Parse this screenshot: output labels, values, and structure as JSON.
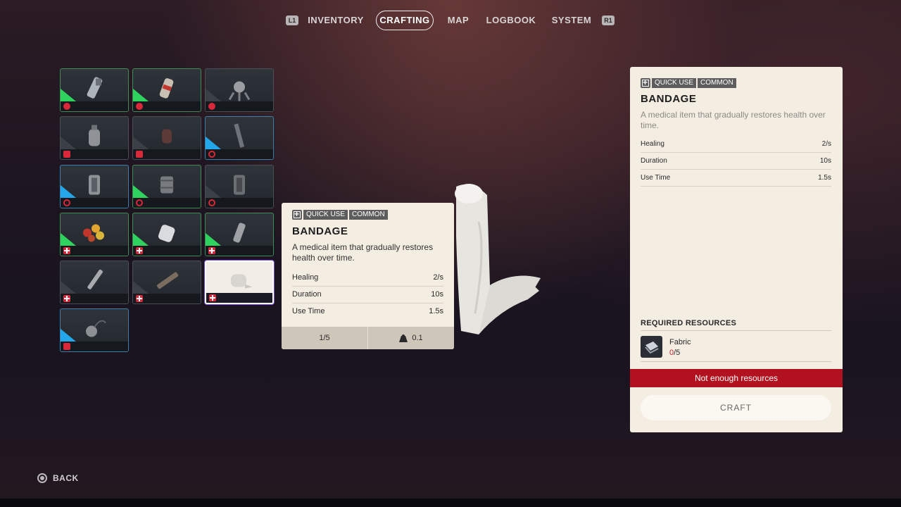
{
  "nav": {
    "left_key": "L1",
    "right_key": "R1",
    "tabs": [
      "INVENTORY",
      "CRAFTING",
      "MAP",
      "LOGBOOK",
      "SYSTEM"
    ],
    "active": "CRAFTING"
  },
  "grid": {
    "items": [
      {
        "name": "stun-gun-icon",
        "rarity": "uncommon",
        "badge": "round"
      },
      {
        "name": "canister-icon",
        "rarity": "uncommon",
        "badge": "round"
      },
      {
        "name": "turret-icon",
        "rarity": "common",
        "badge": "round"
      },
      {
        "name": "bottle-icon",
        "rarity": "common",
        "badge": "dot"
      },
      {
        "name": "grenade-icon",
        "rarity": "common",
        "badge": "dot"
      },
      {
        "name": "flare-icon",
        "rarity": "rare",
        "badge": "target"
      },
      {
        "name": "lantern-icon",
        "rarity": "rare",
        "badge": "target"
      },
      {
        "name": "trap-icon",
        "rarity": "uncommon",
        "badge": "target"
      },
      {
        "name": "lantern-icon-2",
        "rarity": "common",
        "badge": "target"
      },
      {
        "name": "fruit-icon",
        "rarity": "uncommon",
        "badge": "plus"
      },
      {
        "name": "roll-icon",
        "rarity": "uncommon",
        "badge": "plus"
      },
      {
        "name": "spray-icon",
        "rarity": "uncommon",
        "badge": "plus"
      },
      {
        "name": "syringe-icon",
        "rarity": "common",
        "badge": "plus"
      },
      {
        "name": "injector-icon",
        "rarity": "common",
        "badge": "plus"
      },
      {
        "name": "bandage-icon",
        "rarity": "selected",
        "badge": "plus"
      },
      {
        "name": "mine-icon",
        "rarity": "rare",
        "badge": "dot"
      }
    ]
  },
  "tooltip": {
    "tags": [
      "QUICK USE",
      "COMMON"
    ],
    "title": "BANDAGE",
    "description": "A medical item that gradually restores health over time.",
    "stats": [
      {
        "label": "Healing",
        "value": "2/s"
      },
      {
        "label": "Duration",
        "value": "10s"
      },
      {
        "label": "Use Time",
        "value": "1.5s"
      }
    ],
    "stack": "1/5",
    "weight": "0.1"
  },
  "panel": {
    "tags": [
      "QUICK USE",
      "COMMON"
    ],
    "title": "BANDAGE",
    "description": "A medical item that gradually restores health over time.",
    "stats": [
      {
        "label": "Healing",
        "value": "2/s"
      },
      {
        "label": "Duration",
        "value": "10s"
      },
      {
        "label": "Use Time",
        "value": "1.5s"
      }
    ],
    "resources_header": "REQUIRED RESOURCES",
    "resource": {
      "name": "Fabric",
      "have": "0",
      "need": "/5"
    },
    "warning": "Not enough resources",
    "craft_label": "CRAFT"
  },
  "back_label": "BACK",
  "colors": {
    "uncommon": "#2fd25f",
    "rare": "#23a7ea",
    "warning": "#b2121f",
    "panel": "#f3ede2"
  }
}
